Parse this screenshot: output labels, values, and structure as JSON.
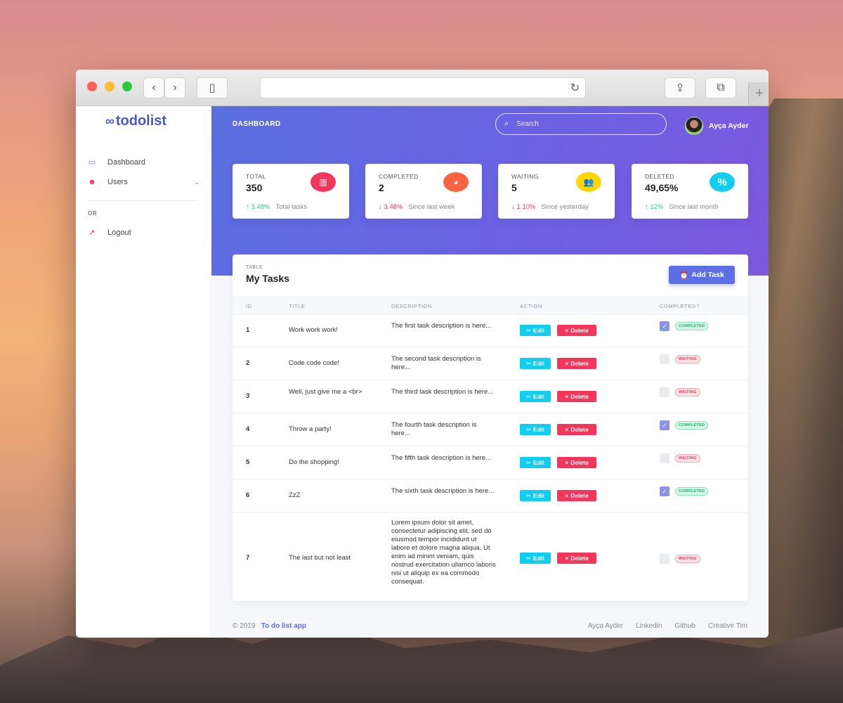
{
  "app": {
    "brand": "todolist",
    "header_title": "DASHBOARD",
    "search_placeholder": "Search",
    "user_name": "Ayça Ayder"
  },
  "sidebar": {
    "items": [
      {
        "label": "Dashboard",
        "icon": "monitor-icon"
      },
      {
        "label": "Users",
        "icon": "user-icon"
      }
    ],
    "or_label": "OR",
    "logout_label": "Logout"
  },
  "stats": [
    {
      "label": "TOTAL",
      "value": "350",
      "change": "3.48%",
      "trend": "up",
      "desc": "Total tasks",
      "icon": "bar-chart-icon",
      "color": "#f5365c"
    },
    {
      "label": "COMPLETED",
      "value": "2",
      "change": "3.48%",
      "trend": "down",
      "desc": "Since last week",
      "icon": "pie-chart-icon",
      "color": "#fb6340"
    },
    {
      "label": "WAITING",
      "value": "5",
      "change": "1.10%",
      "trend": "down",
      "desc": "Since yesterday",
      "icon": "users-icon",
      "color": "#ffd600"
    },
    {
      "label": "DELETED",
      "value": "49,65%",
      "change": "12%",
      "trend": "up",
      "desc": "Since last month",
      "icon": "percent-icon",
      "color": "#11cdef"
    }
  ],
  "tasks_card": {
    "kicker": "TABLE",
    "title": "My Tasks",
    "add_label": "Add Task",
    "columns": [
      "ID",
      "TITLE",
      "DESCRIPTION",
      "ACTION",
      "COMPLETED?"
    ],
    "edit_label": "Edit",
    "delete_label": "Delete",
    "rows": [
      {
        "id": "1",
        "title": "Work work work!",
        "desc": "The first task description is here...",
        "completed": true,
        "status": "COMPLETED"
      },
      {
        "id": "2",
        "title": "Code code code!",
        "desc": "The second task description is here...",
        "completed": false,
        "status": "WAITING"
      },
      {
        "id": "3",
        "title": "Well, just give me a <br>",
        "desc": "The third task description is here...",
        "completed": false,
        "status": "WAITING"
      },
      {
        "id": "4",
        "title": "Throw a party!",
        "desc": "The fourth task description is here...",
        "completed": true,
        "status": "COMPLETED"
      },
      {
        "id": "5",
        "title": "Do the shopping!",
        "desc": "The fifth task description is here...",
        "completed": false,
        "status": "WAITING"
      },
      {
        "id": "6",
        "title": "ZzZ",
        "desc": "The sixth task description is here...",
        "completed": true,
        "status": "COMPLETED"
      },
      {
        "id": "7",
        "title": "The last but not least",
        "desc": "Lorem ipsum dolor sit amet, consectetur adipiscing elit, sed do eiusmod tempor incididunt ut labore et dolore magna aliqua. Ut enim ad minim veniam, quis nostrud exercitation ullamco laboris nisi ut aliquip ex ea commodo consequat.",
        "completed": false,
        "status": "WAITING"
      }
    ]
  },
  "footer": {
    "copyright": "© 2019",
    "app_link": "To do list app",
    "links": [
      "Ayça Ayder",
      "Linkedin",
      "Github",
      "Creative Tim"
    ]
  }
}
